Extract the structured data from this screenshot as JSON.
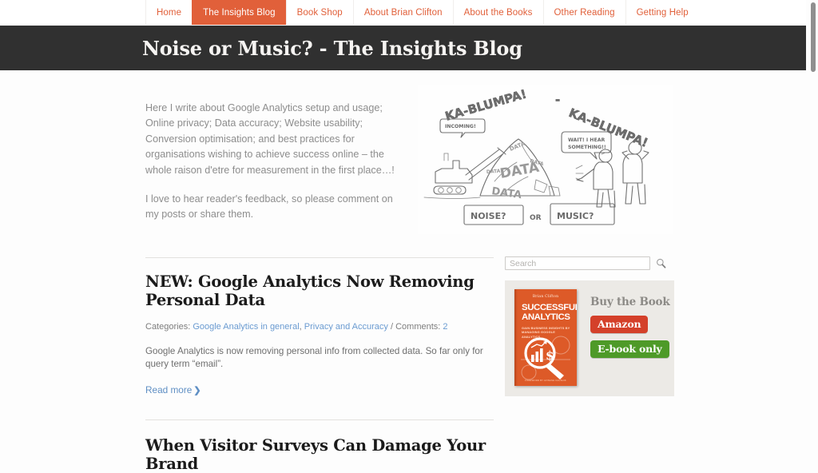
{
  "nav": {
    "items": [
      {
        "label": "Home",
        "active": false
      },
      {
        "label": "The Insights Blog",
        "active": true
      },
      {
        "label": "Book Shop",
        "active": false
      },
      {
        "label": "About Brian Clifton",
        "active": false
      },
      {
        "label": "About the Books",
        "active": false
      },
      {
        "label": "Other Reading",
        "active": false
      },
      {
        "label": "Getting Help",
        "active": false
      }
    ],
    "accent_color": "#e1603a"
  },
  "banner": {
    "title": "Noise or Music? - The Insights Blog",
    "background_color": "#303030"
  },
  "intro": {
    "paragraph1": "Here I write about Google Analytics setup and usage; Online privacy; Data accuracy; Website usability; Conversion optimisation; and best practices for organisations wishing to achieve success online – the whole raison d'etre for measurement in the first place…!",
    "paragraph2": "I love to hear reader's feedback, so please comment on my posts or share them."
  },
  "cartoon": {
    "alt": "hand drawn pencil cartoon of a bulldozer dumping a pile of data rubble while two men listen",
    "shout_left": "KA-BLUMPA!",
    "shout_dash": "-",
    "shout_right": "KA-BLUMPA!",
    "bubble_incoming": "INCOMING!",
    "bubble_wait": "WAIT! I HEAR SOMETHING!!",
    "pile_word": "DATA",
    "caption_left": "NOISE?",
    "caption_mid": "OR",
    "caption_right": "MUSIC?"
  },
  "posts": [
    {
      "title": "NEW: Google Analytics Now Removing Personal Data",
      "meta_categories_label": "Categories:",
      "category1": "Google Analytics in general",
      "meta_separator1": ",",
      "category2": "Privacy and Accuracy",
      "meta_separator2": "/ Comments:",
      "comments": "2",
      "excerpt": "Google Analytics is now removing personal info from collected data. So far only for query term “email”.",
      "read_more": "Read more",
      "read_more_arrow": "❯"
    },
    {
      "title": "When Visitor Surveys Can Damage Your Brand"
    }
  ],
  "sidebar": {
    "search": {
      "placeholder": "Search",
      "value": "",
      "icon": "search-icon"
    },
    "book_widget": {
      "cover": {
        "author": "Brian Clifton",
        "title_line1": "SUCCESSFUL",
        "title_line2": "ANALYTICS",
        "subtitle": "GAIN BUSINESS INSIGHTS BY MANAGING GOOGLE ANALYTICS",
        "footer": "FOREWORD BY AVINASH KAUSHIK",
        "background_color": "#dd5a28"
      },
      "heading": "Buy the Book",
      "buttons": [
        {
          "label": "Amazon",
          "color": "#d4402a"
        },
        {
          "label": "E-book only",
          "color": "#4e9a28"
        }
      ],
      "background_color": "#eceae6"
    }
  },
  "scrollbar": {
    "position": "top"
  }
}
